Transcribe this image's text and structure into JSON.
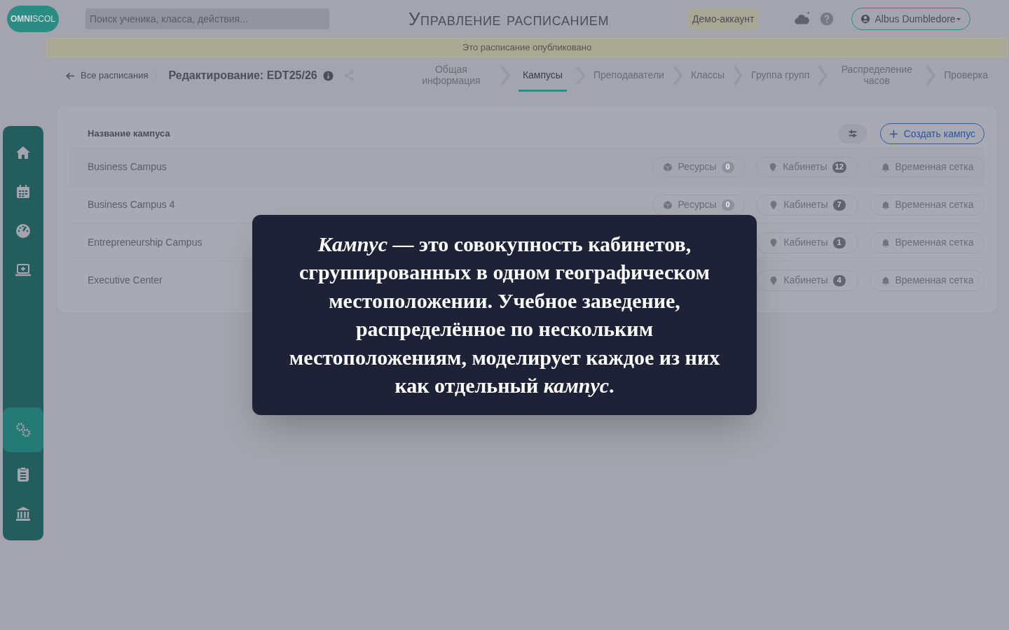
{
  "header": {
    "logo": {
      "bold": "OMNI",
      "light": "SCOL"
    },
    "search": {
      "placeholder": "Поиск ученика, класса, действия..."
    },
    "title": "Управление расписанием",
    "demo_badge": "Демо-аккаунт",
    "user": "Albus Dumbledore"
  },
  "banner": "Это расписание опубликовано",
  "breadcrumb": {
    "back": "Все расписания",
    "title": "Редактирование: EDT25/26"
  },
  "steps": [
    {
      "label": "Общая информация",
      "selected": false
    },
    {
      "label": "Кампусы",
      "selected": true
    },
    {
      "label": "Преподаватели",
      "selected": false
    },
    {
      "label": "Классы",
      "selected": false
    },
    {
      "label": "Группа групп",
      "selected": false
    },
    {
      "label": "Распределение часов",
      "selected": false
    },
    {
      "label": "Проверка",
      "selected": false
    }
  ],
  "sidebar": {
    "items": [
      {
        "kind": "home",
        "selected": false
      },
      {
        "kind": "calendar",
        "selected": false
      },
      {
        "kind": "gauge",
        "selected": false
      },
      {
        "kind": "laptop",
        "selected": false
      },
      {
        "kind": "gears",
        "selected": true
      },
      {
        "kind": "clipboard",
        "selected": false
      },
      {
        "kind": "bank",
        "selected": false
      }
    ]
  },
  "table": {
    "column": "Название кампуса",
    "create_button": "Создать кампус",
    "rows": [
      {
        "name": "Business Campus",
        "chips": [
          {
            "kind": "resources",
            "label": "Ресурсы",
            "count": "0"
          },
          {
            "kind": "rooms",
            "label": "Кабинеты",
            "count": "12"
          },
          {
            "kind": "grid",
            "label": "Временная сетка"
          }
        ]
      },
      {
        "name": "Business Campus 4",
        "chips": [
          {
            "kind": "resources",
            "label": "Ресурсы",
            "count": "0"
          },
          {
            "kind": "rooms",
            "label": "Кабинеты",
            "count": "7"
          },
          {
            "kind": "grid",
            "label": "Временная сетка"
          }
        ]
      },
      {
        "name": "Entrepreneurship Campus",
        "chips": [
          {
            "kind": "rooms",
            "label": "Кабинеты",
            "count": "1"
          },
          {
            "kind": "grid",
            "label": "Временная сетка"
          }
        ]
      },
      {
        "name": "Executive Center",
        "chips": [
          {
            "kind": "rooms",
            "label": "Кабинеты",
            "count": "4"
          },
          {
            "kind": "grid",
            "label": "Временная сетка"
          }
        ]
      }
    ]
  },
  "tooltip": "*Кампус* — это совокупность кабинетов, сгруппированных в одном географическом местоположении. Учебное заведение, распределённое по нескольким местоположениям, моделирует каждое из них как отдельный *кампус*."
}
